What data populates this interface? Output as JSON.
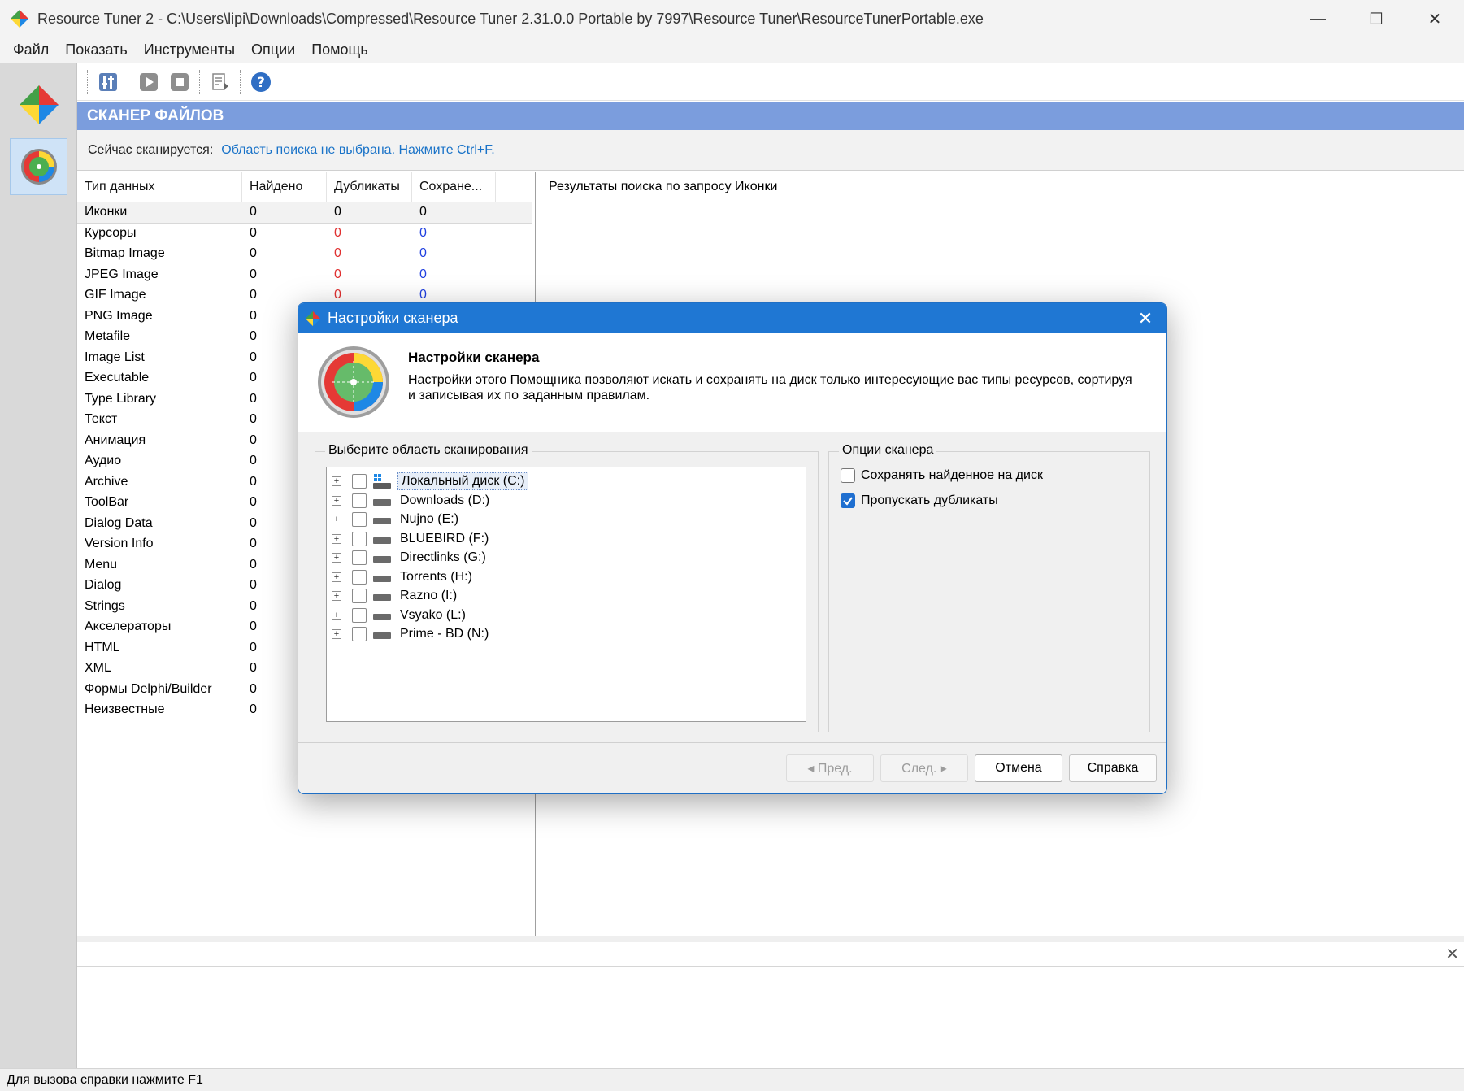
{
  "window": {
    "title": "Resource Tuner 2 - C:\\Users\\lipi\\Downloads\\Compressed\\Resource Tuner 2.31.0.0 Portable by 7997\\Resource Tuner\\ResourceTunerPortable.exe",
    "minimize": "—",
    "maximize": "☐",
    "close": "✕"
  },
  "menu": [
    "Файл",
    "Показать",
    "Инструменты",
    "Опции",
    "Помощь"
  ],
  "header": {
    "band_title": "СКАНЕР ФАЙЛОВ",
    "scanning_label": "Сейчас сканируется:",
    "scanning_value": "Область поиска не выбрана. Нажмите Ctrl+F."
  },
  "table": {
    "columns": [
      "Тип данных",
      "Найдено",
      "Дубликаты",
      "Сохране..."
    ],
    "rows": [
      {
        "type": "Иконки",
        "found": "0",
        "dups": "0",
        "saved": "0"
      },
      {
        "type": "Курсоры",
        "found": "0",
        "dups": "0",
        "saved": "0"
      },
      {
        "type": "Bitmap Image",
        "found": "0",
        "dups": "0",
        "saved": "0"
      },
      {
        "type": "JPEG Image",
        "found": "0",
        "dups": "0",
        "saved": "0"
      },
      {
        "type": "GIF Image",
        "found": "0",
        "dups": "0",
        "saved": "0"
      },
      {
        "type": "PNG Image",
        "found": "0",
        "dups": "",
        "saved": ""
      },
      {
        "type": "Metafile",
        "found": "0",
        "dups": "",
        "saved": ""
      },
      {
        "type": "Image List",
        "found": "0",
        "dups": "",
        "saved": ""
      },
      {
        "type": "Executable",
        "found": "0",
        "dups": "",
        "saved": ""
      },
      {
        "type": "Type Library",
        "found": "0",
        "dups": "",
        "saved": ""
      },
      {
        "type": "Текст",
        "found": "0",
        "dups": "",
        "saved": ""
      },
      {
        "type": "Анимация",
        "found": "0",
        "dups": "",
        "saved": ""
      },
      {
        "type": "Аудио",
        "found": "0",
        "dups": "",
        "saved": ""
      },
      {
        "type": "Archive",
        "found": "0",
        "dups": "",
        "saved": ""
      },
      {
        "type": "ToolBar",
        "found": "0",
        "dups": "",
        "saved": ""
      },
      {
        "type": "Dialog Data",
        "found": "0",
        "dups": "",
        "saved": ""
      },
      {
        "type": "Version Info",
        "found": "0",
        "dups": "",
        "saved": ""
      },
      {
        "type": "Menu",
        "found": "0",
        "dups": "",
        "saved": ""
      },
      {
        "type": "Dialog",
        "found": "0",
        "dups": "",
        "saved": ""
      },
      {
        "type": "Strings",
        "found": "0",
        "dups": "",
        "saved": ""
      },
      {
        "type": "Акселераторы",
        "found": "0",
        "dups": "",
        "saved": ""
      },
      {
        "type": "HTML",
        "found": "0",
        "dups": "",
        "saved": ""
      },
      {
        "type": "XML",
        "found": "0",
        "dups": "",
        "saved": ""
      },
      {
        "type": "Формы Delphi/Builder",
        "found": "0",
        "dups": "",
        "saved": ""
      },
      {
        "type": "Неизвестные",
        "found": "0",
        "dups": "",
        "saved": ""
      }
    ]
  },
  "results": {
    "header": "Результаты поиска по запросу Иконки"
  },
  "bottom": {
    "close": "✕"
  },
  "status": {
    "text": "Для вызова справки нажмите F1"
  },
  "dialog": {
    "title": "Настройки сканера",
    "close": "✕",
    "heading": "Настройки сканера",
    "description": "Настройки этого Помощника позволяют искать и сохранять на диск только интересующие вас типы ресурсов, сортируя и записывая их по заданным правилам.",
    "scan_area_label": "Выберите область сканирования",
    "drives": [
      "Локальный диск (C:)",
      "Downloads (D:)",
      "Nujno (E:)",
      "BLUEBIRD (F:)",
      "Directlinks (G:)",
      "Torrents (H:)",
      "Razno (I:)",
      "Vsyako (L:)",
      "Prime - BD (N:)"
    ],
    "options_label": "Опции сканера",
    "options": [
      {
        "label": "Сохранять найденное на диск",
        "checked": false
      },
      {
        "label": "Пропускать дубликаты",
        "checked": true
      }
    ],
    "buttons": {
      "prev": "◂ Пред.",
      "next": "След. ▸",
      "cancel": "Отмена",
      "help": "Справка"
    }
  },
  "colors": {
    "band": "#7b9ddd",
    "dialog_title": "#1f77d3",
    "link": "#1a73c8",
    "dup_red": "#e03030",
    "saved_blue": "#2040e0"
  },
  "icons": [
    "app-logo-icon",
    "scanner-radar-icon",
    "settings-icon",
    "play-icon",
    "stop-icon",
    "export-icon",
    "help-icon",
    "windows-drive-icon",
    "drive-icon"
  ]
}
